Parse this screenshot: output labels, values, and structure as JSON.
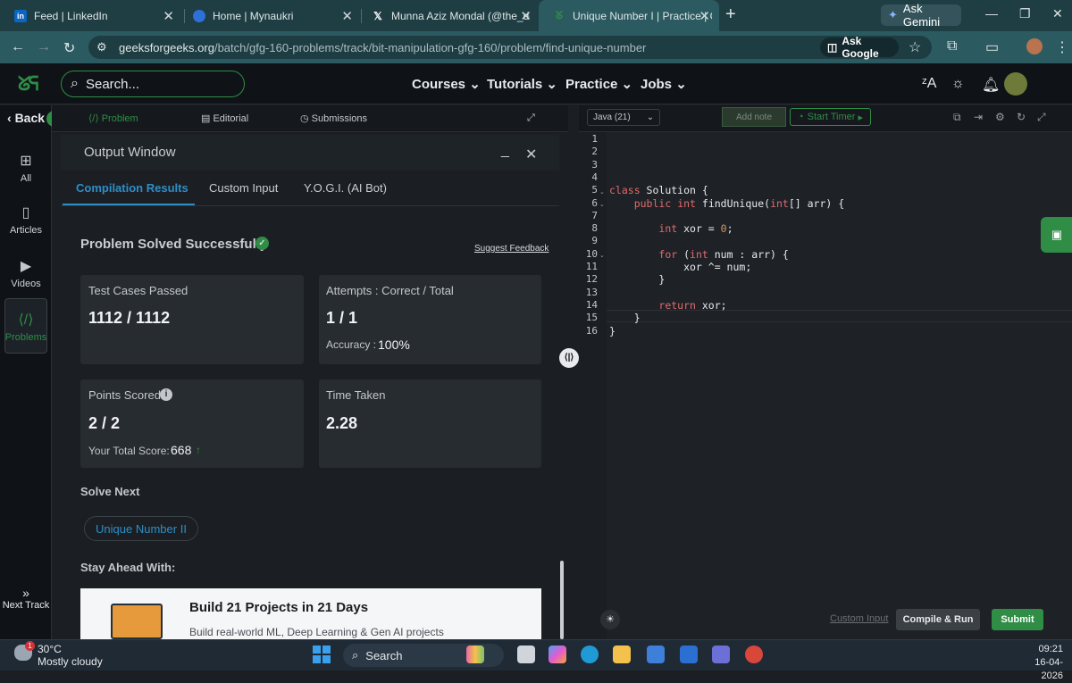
{
  "browser": {
    "tabs": [
      {
        "title": "Feed | LinkedIn",
        "icon": "linkedin-icon",
        "icon_text": "in",
        "icon_color": "#0a66c2"
      },
      {
        "title": "Home | Mynaukri",
        "icon": "mynaukri-icon",
        "icon_text": "",
        "icon_color": "#2e6fd8"
      },
      {
        "title": "Munna Aziz Mondal (@the_dep",
        "icon": "x-icon",
        "icon_text": "𝕏",
        "icon_color": "#000000"
      },
      {
        "title": "Unique Number I | Practice | Ge",
        "icon": "gfg-icon",
        "icon_text": "ᘜ",
        "icon_color": "#2f8d46"
      }
    ],
    "ask_gemini": "Ask Gemini",
    "url_host": "geeksforgeeks.org",
    "url_path": "/batch/gfg-160-problems/track/bit-manipulation-gfg-160/problem/find-unique-number",
    "ask_google": "Ask Google"
  },
  "site": {
    "search_placeholder": "Search...",
    "nav": [
      "Courses",
      "Tutorials",
      "Practice",
      "Jobs"
    ]
  },
  "rail": {
    "back": "Back",
    "items": [
      {
        "label": "All",
        "icon": "grid-icon"
      },
      {
        "label": "Articles",
        "icon": "book-icon"
      },
      {
        "label": "Videos",
        "icon": "video-icon"
      },
      {
        "label": "Problems",
        "icon": "code-icon"
      }
    ],
    "next_track": "Next Track"
  },
  "problem_tabs": [
    "Problem",
    "Editorial",
    "Submissions"
  ],
  "output": {
    "title": "Output Window",
    "tabs": [
      "Compilation Results",
      "Custom Input",
      "Y.O.G.I. (AI Bot)"
    ],
    "status": "Problem Solved Successfully",
    "feedback": "Suggest Feedback",
    "test_cases_label": "Test Cases Passed",
    "test_cases_value": "1112 / 1112",
    "attempts_label": "Attempts : Correct / Total",
    "attempts_value": "1 / 1",
    "accuracy_label": "Accuracy :",
    "accuracy_value": "100%",
    "points_label": "Points Scored",
    "points_value": "2 / 2",
    "total_score_label": "Your Total Score:",
    "total_score_value": "668",
    "time_label": "Time Taken",
    "time_value": "2.28",
    "solve_next": "Solve Next",
    "next_problem": "Unique Number II",
    "stay_ahead": "Stay Ahead With:",
    "promo_title": "Build 21 Projects in 21 Days",
    "promo_sub": "Build real-world ML, Deep Learning & Gen AI projects"
  },
  "editor": {
    "language": "Java (21)",
    "add_note": "Add note",
    "start_timer": "Start Timer",
    "line_numbers": [
      "1",
      "2",
      "3",
      "4",
      "5",
      "6",
      "7",
      "8",
      "9",
      "10",
      "11",
      "12",
      "13",
      "14",
      "15",
      "16"
    ],
    "code_lines": [
      "",
      "",
      "",
      "",
      "class Solution {",
      "    public int findUnique(int[] arr) {",
      "",
      "        int xor = 0;",
      "",
      "        for (int num : arr) {",
      "            xor ^= num;",
      "        }",
      "",
      "        return xor;",
      "    }",
      "}"
    ],
    "custom_input": "Custom Input",
    "compile_run": "Compile & Run",
    "submit": "Submit"
  },
  "taskbar": {
    "temperature": "30°C",
    "weather": "Mostly cloudy",
    "search": "Search",
    "time": "09:21",
    "date": "16-04-2026",
    "badge": "1"
  }
}
